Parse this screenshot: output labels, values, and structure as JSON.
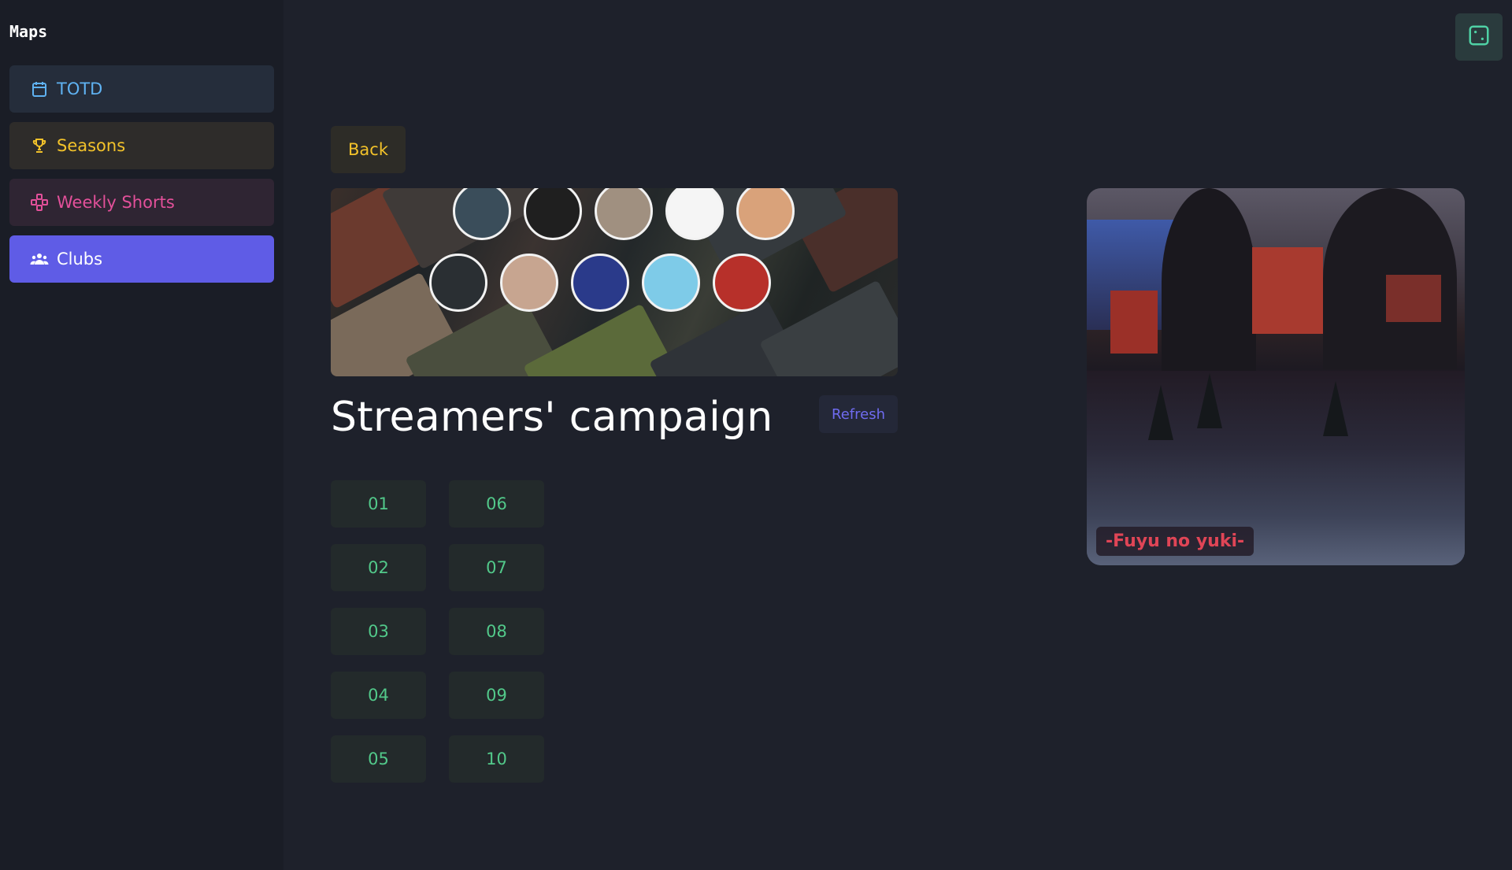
{
  "sidebar": {
    "title": "Maps",
    "items": [
      {
        "label": "TOTD",
        "icon": "calendar-icon",
        "color": "#5fb2f2"
      },
      {
        "label": "Seasons",
        "icon": "trophy-icon",
        "color": "#f2c22a"
      },
      {
        "label": "Weekly Shorts",
        "icon": "gamepad-icon",
        "color": "#e3509a"
      },
      {
        "label": "Clubs",
        "icon": "users-icon",
        "color": "#ffffff",
        "active": true
      }
    ]
  },
  "toolbar": {
    "random_icon": "dice-icon"
  },
  "campaign": {
    "back_label": "Back",
    "title": "Streamers' campaign",
    "refresh_label": "Refresh",
    "maps": [
      "01",
      "02",
      "03",
      "04",
      "05",
      "06",
      "07",
      "08",
      "09",
      "10"
    ]
  },
  "preview": {
    "map_name": "-Fuyu no yuki-"
  },
  "colors": {
    "background": "#1e212b",
    "sidebar_bg": "#1a1d26",
    "accent": "#5f5ce6",
    "map_button_text": "#52c98a",
    "map_name_text": "#e04556"
  }
}
